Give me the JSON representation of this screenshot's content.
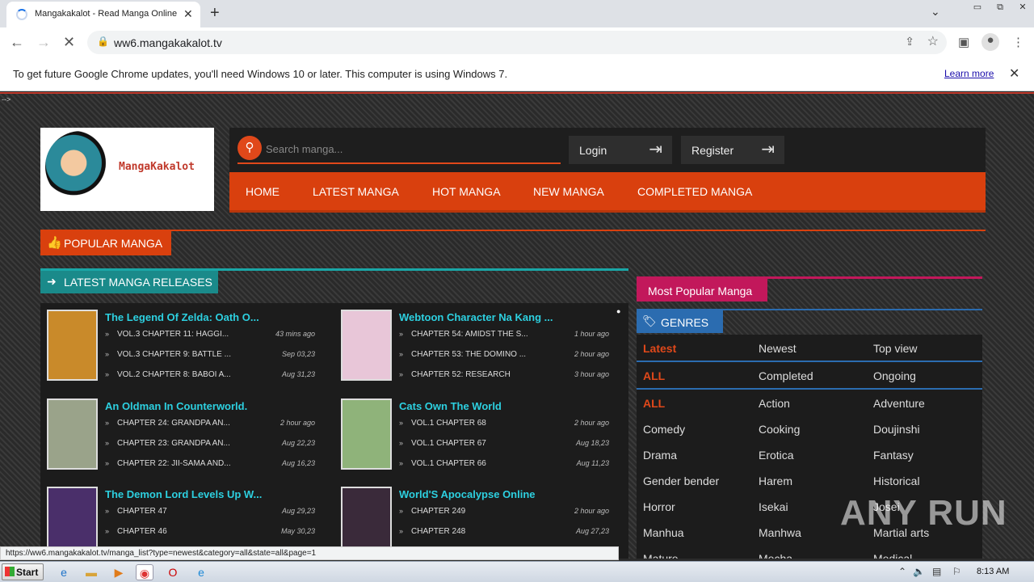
{
  "browser": {
    "tab_title": "Mangakakalot - Read Manga Online F",
    "url": "ww6.mangakakalot.tv",
    "infobar_message": "To get future Google Chrome updates, you'll need Windows 10 or later. This computer is using Windows 7.",
    "infobar_link": "Learn more",
    "status_url": "https://ww6.mangakakalot.tv/manga_list?type=newest&category=all&state=all&page=1"
  },
  "site": {
    "logo_text": "MangaKakalot",
    "search_placeholder": "Search manga...",
    "login_label": "Login",
    "register_label": "Register",
    "nav": [
      "HOME",
      "LATEST MANGA",
      "HOT MANGA",
      "NEW MANGA",
      "COMPLETED MANGA"
    ],
    "popular_label": "POPULAR MANGA",
    "latest_label": "LATEST MANGA RELEASES",
    "most_popular_label": "Most Popular Manga",
    "genres_label": "GENRES"
  },
  "latest_items": [
    {
      "title": "The Legend Of Zelda: Oath O...",
      "cover_color": "#c98a2a",
      "chapters": [
        {
          "name": "VOL.3 CHAPTER 11: HAGGI...",
          "time": "43 mins ago"
        },
        {
          "name": "VOL.3 CHAPTER 9: BATTLE ...",
          "time": "Sep 03,23"
        },
        {
          "name": "VOL.2 CHAPTER 8: BABOI A...",
          "time": "Aug 31,23"
        }
      ]
    },
    {
      "title": "Webtoon Character Na Kang ...",
      "cover_color": "#e8c6d8",
      "chapters": [
        {
          "name": "CHAPTER 54: AMIDST THE S...",
          "time": "1 hour ago"
        },
        {
          "name": "CHAPTER 53: THE DOMINO ...",
          "time": "2 hour ago"
        },
        {
          "name": "CHAPTER 52: RESEARCH",
          "time": "3 hour ago"
        }
      ]
    },
    {
      "title": "An Oldman In Counterworld.",
      "cover_color": "#9aa38a",
      "chapters": [
        {
          "name": "CHAPTER 24: GRANDPA AN...",
          "time": "2 hour ago"
        },
        {
          "name": "CHAPTER 23: GRANDPA AN...",
          "time": "Aug 22,23"
        },
        {
          "name": "CHAPTER 22: JII-SAMA AND...",
          "time": "Aug 16,23"
        }
      ]
    },
    {
      "title": "Cats Own The World",
      "cover_color": "#8fb37a",
      "chapters": [
        {
          "name": "VOL.1 CHAPTER 68",
          "time": "2 hour ago"
        },
        {
          "name": "VOL.1 CHAPTER 67",
          "time": "Aug 18,23"
        },
        {
          "name": "VOL.1 CHAPTER 66",
          "time": "Aug 11,23"
        }
      ]
    },
    {
      "title": "The Demon Lord Levels Up W...",
      "cover_color": "#4a2f6a",
      "chapters": [
        {
          "name": "CHAPTER 47",
          "time": "Aug 29,23"
        },
        {
          "name": "CHAPTER 46",
          "time": "May 30,23"
        }
      ]
    },
    {
      "title": "World'S Apocalypse Online",
      "cover_color": "#3a2a3a",
      "chapters": [
        {
          "name": "CHAPTER 249",
          "time": "2 hour ago"
        },
        {
          "name": "CHAPTER 248",
          "time": "Aug 27,23"
        }
      ]
    }
  ],
  "genres": [
    [
      "Latest",
      "Newest",
      "Top view"
    ],
    [
      "ALL",
      "Completed",
      "Ongoing"
    ],
    [
      "ALL",
      "Action",
      "Adventure"
    ],
    [
      "Comedy",
      "Cooking",
      "Doujinshi"
    ],
    [
      "Drama",
      "Erotica",
      "Fantasy"
    ],
    [
      "Gender bender",
      "Harem",
      "Historical"
    ],
    [
      "Horror",
      "Isekai",
      "Josei"
    ],
    [
      "Manhua",
      "Manhwa",
      "Martial arts"
    ],
    [
      "Mature",
      "Mecha",
      "Medical"
    ]
  ],
  "watermark": "ANY RUN",
  "taskbar": {
    "start_label": "Start",
    "clock": "8:13 AM"
  }
}
